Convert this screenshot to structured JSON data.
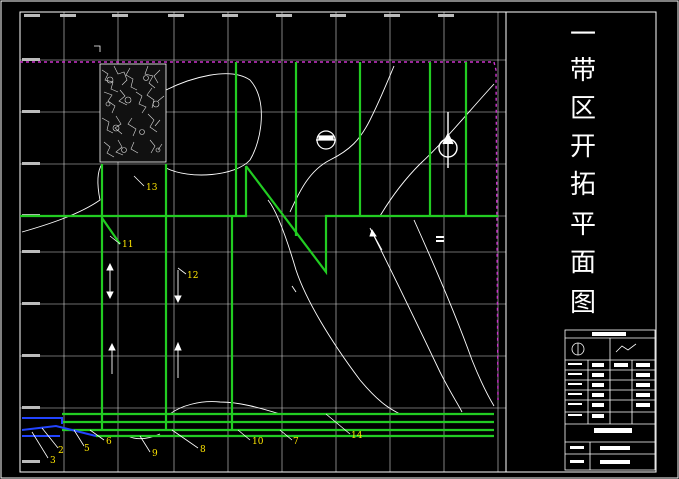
{
  "title_chars": [
    "一",
    "带",
    "区",
    "开",
    "拓",
    "平",
    "面",
    "图"
  ],
  "callouts": [
    "2",
    "3",
    "5",
    "6",
    "7",
    "8",
    "9",
    "10",
    "11",
    "12",
    "13",
    "14"
  ],
  "colors": {
    "background": "#000000",
    "frame": "#ffffff",
    "grid": "#ffffff",
    "main_lines": "#22cc22",
    "callout_text": "#ffe600",
    "boundary_dash": "#cc33cc",
    "blue_lines": "#2244ff"
  },
  "icons": [
    "north-arrow-icon",
    "survey-mark-icon",
    "flow-arrow-icon",
    "hatched-area"
  ]
}
